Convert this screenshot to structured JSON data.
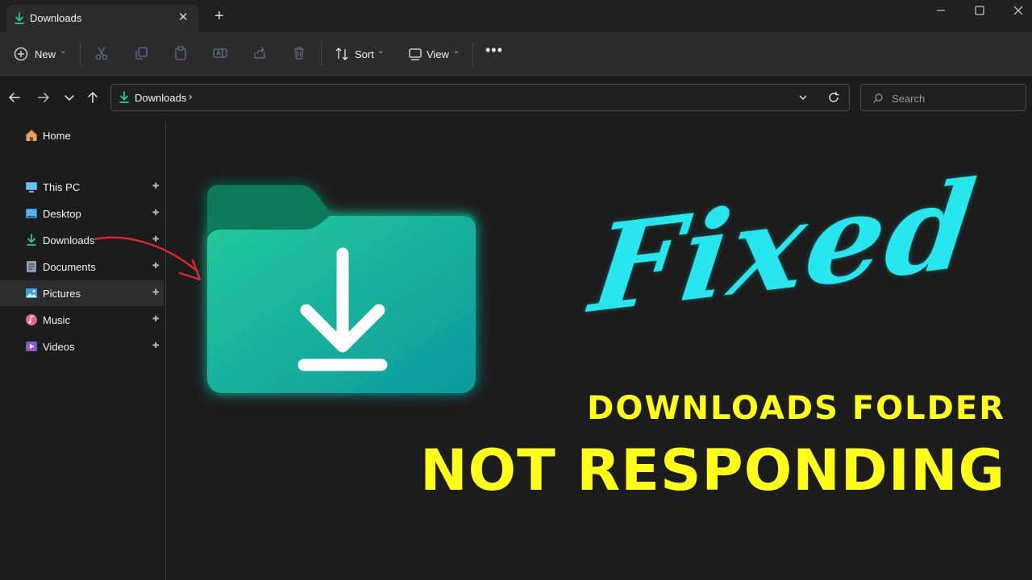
{
  "window": {
    "tab_title": "Downloads",
    "tab_close_glyph": "✕",
    "new_tab_glyph": "+"
  },
  "toolbar": {
    "new_label": "New",
    "sort_label": "Sort",
    "view_label": "View",
    "more_glyph": "•••",
    "icons": [
      "cut-icon",
      "copy-icon",
      "paste-icon",
      "rename-icon",
      "share-icon",
      "delete-icon"
    ]
  },
  "address": {
    "crumb": "Downloads",
    "crumb_separator": "›"
  },
  "search": {
    "placeholder": "Search"
  },
  "sidebar": {
    "items": [
      {
        "label": "Home",
        "icon": "home-icon"
      },
      {
        "label": "This PC",
        "icon": "monitor-icon"
      },
      {
        "label": "Desktop",
        "icon": "desktop-icon"
      },
      {
        "label": "Downloads",
        "icon": "download-icon"
      },
      {
        "label": "Documents",
        "icon": "documents-icon"
      },
      {
        "label": "Pictures",
        "icon": "pictures-icon"
      },
      {
        "label": "Music",
        "icon": "music-icon"
      },
      {
        "label": "Videos",
        "icon": "videos-icon"
      }
    ],
    "active_label": "Pictures",
    "pin_glyph": "📌"
  },
  "overlay": {
    "script_word": "Fixed",
    "line1": "DOWNLOADS FOLDER",
    "line2": "NOT RESPONDING"
  },
  "colors": {
    "background": "#1c1c1c",
    "accent_green": "#1fb58a",
    "script_cyan": "#27e6ee",
    "headline_yellow": "#ffff19",
    "arrow_red": "#e0262b"
  }
}
